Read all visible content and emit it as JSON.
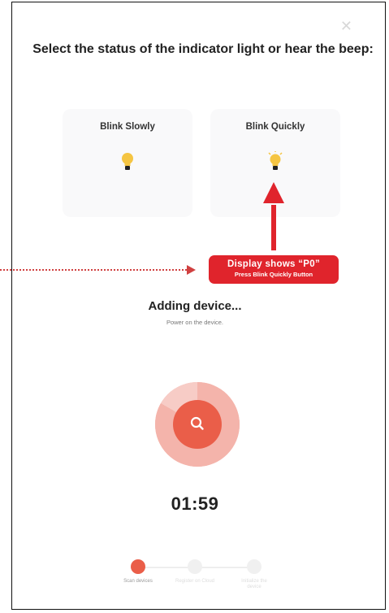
{
  "header": {
    "title": "Select the status of the indicator light or hear the beep:",
    "close_icon": "close-icon"
  },
  "options": [
    {
      "label": "Blink Slowly",
      "icon": "lightbulb-icon"
    },
    {
      "label": "Blink Quickly",
      "icon": "lightbulb-icon"
    }
  ],
  "callout": {
    "line1": "Display shows “P0”",
    "line2": "Press Blink Quickly Button",
    "color": "#e0242c"
  },
  "status": {
    "title": "Adding device...",
    "subtitle": "Power on the device."
  },
  "scanner": {
    "icon": "search-icon",
    "color": "#ea5e49"
  },
  "timer": "01:59",
  "steps": [
    {
      "label": "Scan devices",
      "active": true
    },
    {
      "label": "Register on Cloud",
      "active": false
    },
    {
      "label": "Initialize the device",
      "active": false
    }
  ]
}
